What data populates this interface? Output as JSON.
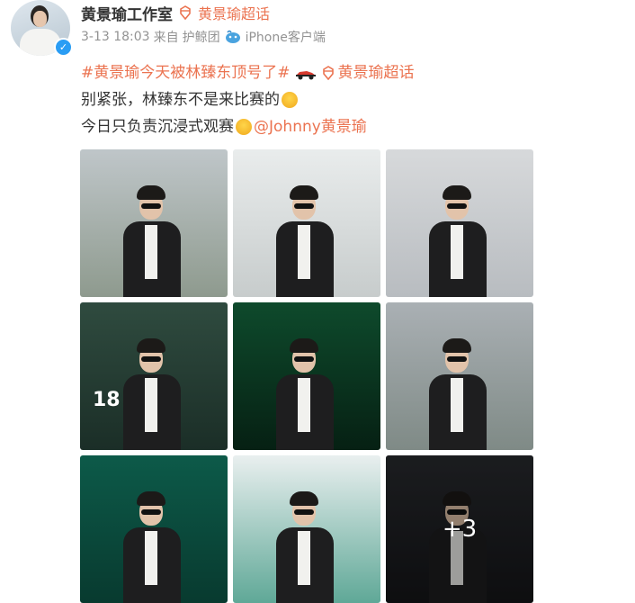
{
  "post": {
    "author": "黄景瑜工作室",
    "super_topic": "黄景瑜超话",
    "date": "3-13 18:03",
    "from_prefix": "来自",
    "source_app": "护鲸团",
    "client": "iPhone客户端",
    "content": {
      "topic_tag": "#黄景瑜今天被林臻东顶号了#",
      "super_topic_link": "黄景瑜超话",
      "line2": "别紧张，林臻东不是来比赛的",
      "line3": "今日只负责沉浸式观赛",
      "mention": "@Johnny黄景瑜"
    },
    "images": [
      {
        "id": "photo-1",
        "label": "",
        "bg": [
          "#bfc6c9",
          "#8e9a8e"
        ]
      },
      {
        "id": "photo-2",
        "label": "",
        "bg": [
          "#e9ecec",
          "#c7cccc"
        ]
      },
      {
        "id": "photo-3",
        "label": "",
        "bg": [
          "#d7d9db",
          "#b8bcc0"
        ]
      },
      {
        "id": "photo-4",
        "label": "18",
        "bg": [
          "#2f4b3f",
          "#1b2e27"
        ]
      },
      {
        "id": "photo-5",
        "label": "",
        "bg": [
          "#0e4a2c",
          "#062013"
        ]
      },
      {
        "id": "photo-6",
        "label": "",
        "bg": [
          "#aab0b4",
          "#7f8a86"
        ]
      },
      {
        "id": "photo-7",
        "label": "",
        "bg": [
          "#0d5a49",
          "#083a2f"
        ]
      },
      {
        "id": "photo-8",
        "label": "",
        "bg": [
          "#e9efef",
          "#5fa897"
        ]
      },
      {
        "id": "photo-9",
        "label": "+3",
        "bg": [
          "#2a2c30",
          "#151619"
        ]
      }
    ]
  },
  "colors": {
    "accent": "#eb7350",
    "text": "#333333",
    "meta": "#939393",
    "verified": "#2a9df4"
  }
}
